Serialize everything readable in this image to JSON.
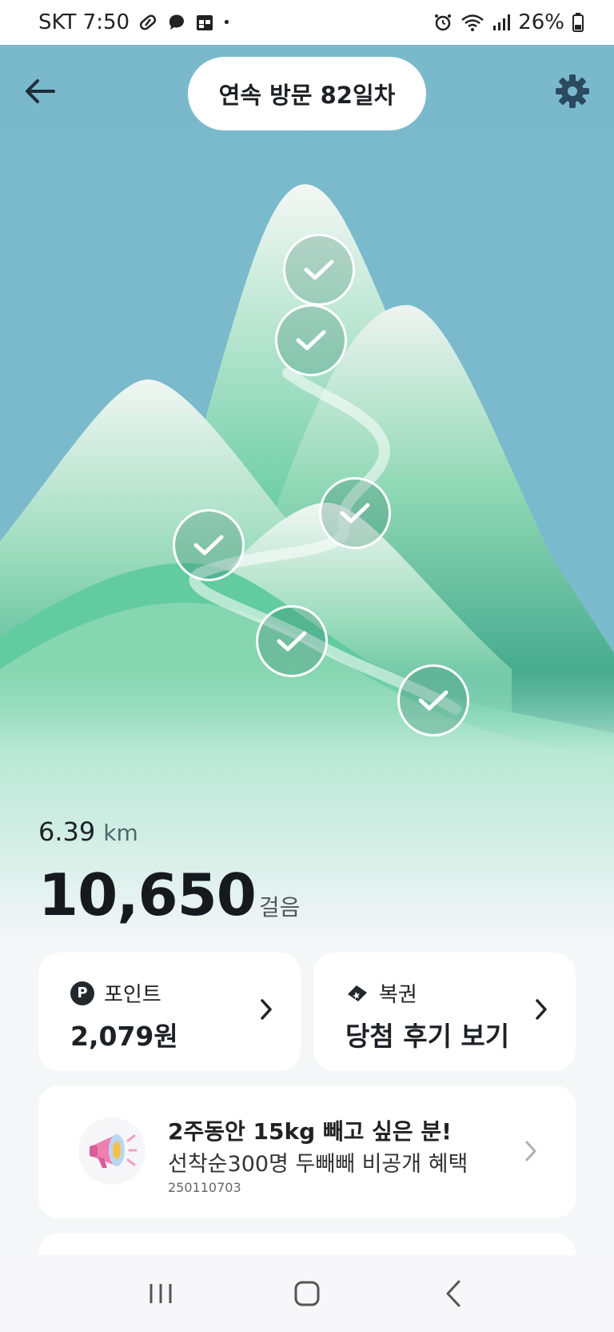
{
  "status_bar": {
    "carrier_time": "SKT 7:50",
    "dot": "•",
    "battery": "26%"
  },
  "header": {
    "streak": "연속 방문 82일차"
  },
  "stats": {
    "distance_value": "6.39",
    "distance_unit": "km",
    "steps_value": "10,650",
    "steps_unit": "걸음"
  },
  "cards": {
    "points": {
      "badge": "P",
      "label": "포인트",
      "value": "2,079원"
    },
    "lottery": {
      "label": "복권",
      "value": "당첨 후기 보기"
    }
  },
  "promo": {
    "title": "2주동안 15kg 빼고 싶은 분!",
    "subtitle": "선착순300명 두빼빼 비공개 혜택",
    "code": "250110703"
  },
  "colors": {
    "sky": "#7ab9cc",
    "mountain_green": "#3fbd8c",
    "card_bg": "#ffffff",
    "page_bg": "#f5f6f8"
  },
  "icons": [
    "back-arrow-icon",
    "gear-icon",
    "check-icon",
    "ticket-icon",
    "chevron-right-icon",
    "megaphone-icon",
    "recent-apps-icon",
    "home-icon",
    "nav-back-icon"
  ]
}
